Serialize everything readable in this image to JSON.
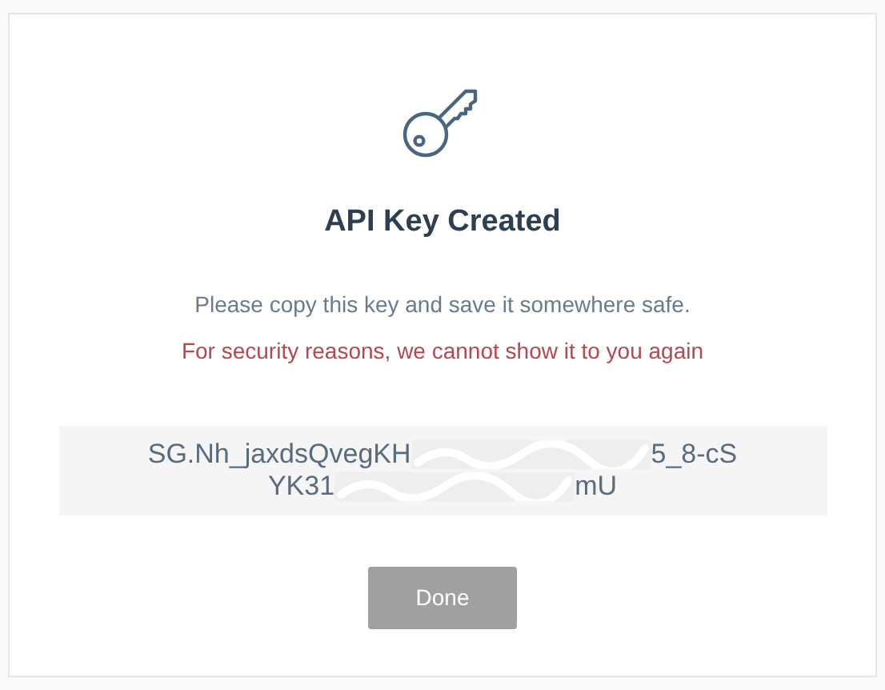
{
  "dialog": {
    "title": "API Key Created",
    "message": "Please copy this key and save it somewhere safe.",
    "warning": "For security reasons, we cannot show it to you again",
    "api_key_lines": [
      [
        "SG.Nh_jaxdsQvegKH",
        "5_8-cS"
      ],
      [
        "YK31",
        "mU"
      ]
    ],
    "buttons": [
      {
        "label": "Done",
        "disabled": true
      }
    ]
  }
}
